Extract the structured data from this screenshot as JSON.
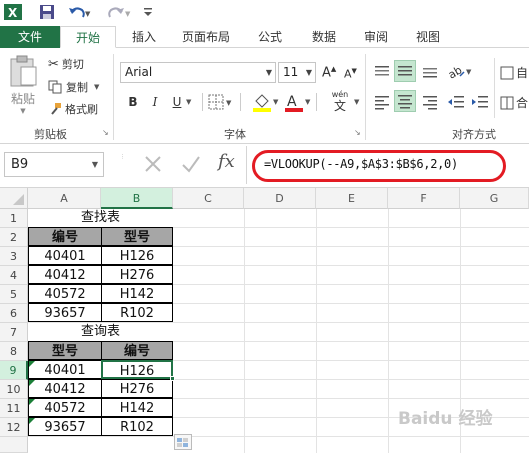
{
  "tabs": [
    "文件",
    "开始",
    "插入",
    "页面布局",
    "公式",
    "数据",
    "审阅",
    "视图"
  ],
  "clipboard": {
    "paste": "粘贴",
    "cut": "剪切",
    "copy": "复制",
    "format_painter": "格式刷",
    "group": "剪贴板"
  },
  "font": {
    "name": "Arial",
    "size": "11",
    "group": "字体",
    "bold": "B",
    "italic": "I",
    "underline": "U",
    "wen": "wén",
    "wen_char": "文"
  },
  "alignment": {
    "group": "对齐方式",
    "extra1": "自",
    "extra2": "合"
  },
  "name_box": "B9",
  "formula": "=VLOOKUP(--A9,$A$3:$B$6,2,0)",
  "fx": "fx",
  "columns": [
    "A",
    "B",
    "C",
    "D",
    "E",
    "F",
    "G"
  ],
  "rows": [
    "1",
    "2",
    "3",
    "4",
    "5",
    "6",
    "7",
    "8",
    "9",
    "10",
    "11",
    "12"
  ],
  "sheet": {
    "title1": "查找表",
    "header1": [
      "编号",
      "型号"
    ],
    "table1": [
      [
        "40401",
        "H126"
      ],
      [
        "40412",
        "H276"
      ],
      [
        "40572",
        "H142"
      ],
      [
        "93657",
        "R102"
      ]
    ],
    "title2": "查询表",
    "header2": [
      "型号",
      "编号"
    ],
    "table2": [
      [
        "40401",
        "H126"
      ],
      [
        "40412",
        "H276"
      ],
      [
        "40572",
        "H142"
      ],
      [
        "93657",
        "R102"
      ]
    ]
  },
  "watermark": "Baidu 经验",
  "colors": {
    "excel_green": "#217346",
    "formula_highlight": "#e31b23",
    "header_fill": "#a6a6a6"
  }
}
